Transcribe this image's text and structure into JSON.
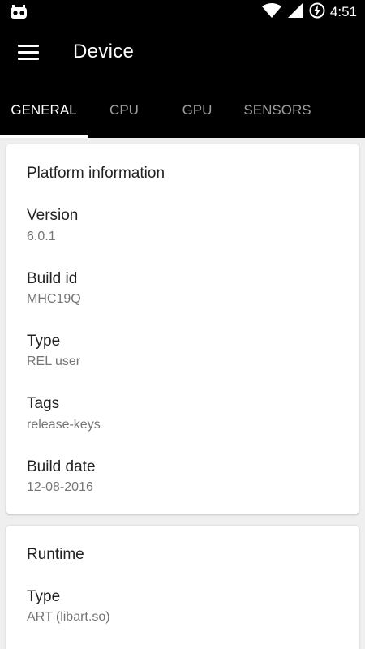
{
  "status_bar": {
    "time": "4:51",
    "icons": [
      "bug-icon",
      "wifi-icon",
      "cell-signal-icon",
      "battery-charging-icon"
    ]
  },
  "app_bar": {
    "title": "Device",
    "menu_icon": "hamburger-menu-icon"
  },
  "tabs": [
    {
      "label": "GENERAL",
      "active": true
    },
    {
      "label": "CPU",
      "active": false
    },
    {
      "label": "GPU",
      "active": false
    },
    {
      "label": "SENSORS",
      "active": false
    }
  ],
  "cards": [
    {
      "title": "Platform information",
      "rows": [
        {
          "label": "Version",
          "value": "6.0.1"
        },
        {
          "label": "Build id",
          "value": "MHC19Q"
        },
        {
          "label": "Type",
          "value": "REL user"
        },
        {
          "label": "Tags",
          "value": "release-keys"
        },
        {
          "label": "Build date",
          "value": "12-08-2016"
        }
      ]
    },
    {
      "title": "Runtime",
      "rows": [
        {
          "label": "Type",
          "value": "ART (libart.so)"
        }
      ]
    }
  ],
  "colors": {
    "app_bar_bg": "#000000",
    "tab_inactive": "#9e9e9e",
    "tab_active": "#ffffff",
    "page_bg": "#efefef",
    "secondary_text": "#757575"
  }
}
